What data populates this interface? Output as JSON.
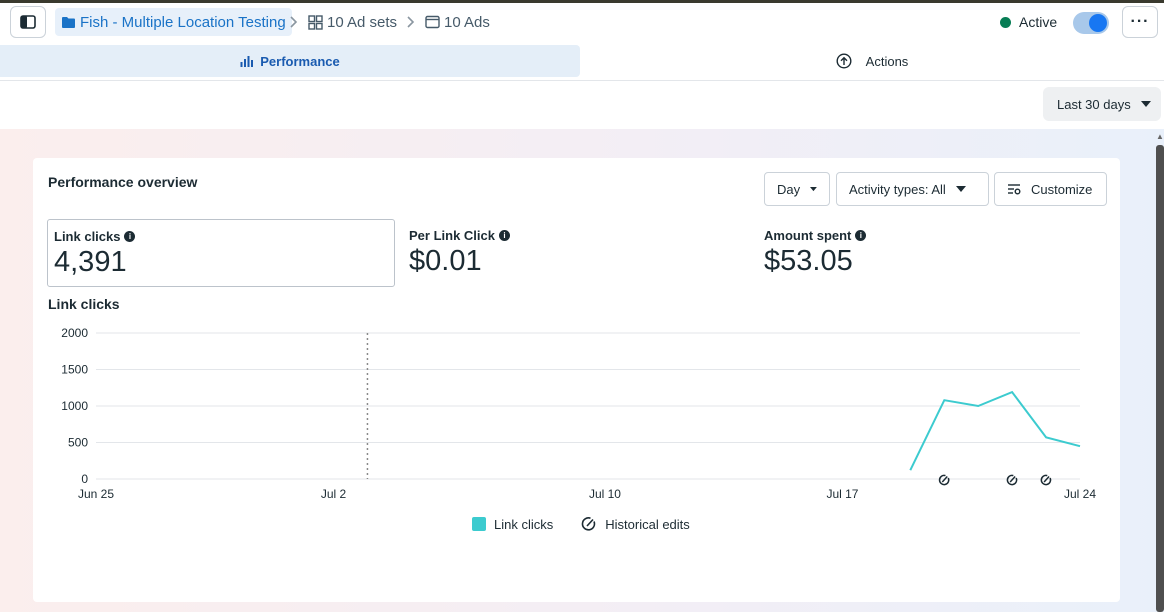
{
  "breadcrumb": {
    "campaign": "Fish - Multiple Location Testing",
    "adsets": "10 Ad sets",
    "ads": "10 Ads"
  },
  "status": {
    "label": "Active",
    "color": "#077d55"
  },
  "tabs": {
    "performance": "Performance",
    "actions": "Actions"
  },
  "date_range": "Last 30 days",
  "card": {
    "title": "Performance overview",
    "day_label": "Day",
    "activity_label": "Activity types: All",
    "customize_label": "Customize"
  },
  "metrics": [
    {
      "label": "Link clicks",
      "value": "4,391"
    },
    {
      "label": "Per Link Click",
      "value": "$0.01"
    },
    {
      "label": "Amount spent",
      "value": "$53.05"
    }
  ],
  "chart_title": "Link clicks",
  "legend": {
    "series": "Link clicks",
    "edits": "Historical edits"
  },
  "chart_data": {
    "type": "line",
    "x_ticks": [
      "Jun 25",
      "Jul 2",
      "Jul 10",
      "Jul 17",
      "Jul 24"
    ],
    "y_ticks": [
      0,
      500,
      1000,
      1500,
      2000
    ],
    "ylim": [
      0,
      2000
    ],
    "grid": true,
    "series": [
      {
        "name": "Link clicks",
        "color": "#3ccbcf",
        "points": [
          {
            "x": "Jul 19",
            "y": 120
          },
          {
            "x": "Jul 20",
            "y": 1080
          },
          {
            "x": "Jul 21",
            "y": 1000
          },
          {
            "x": "Jul 22",
            "y": 1190
          },
          {
            "x": "Jul 23",
            "y": 570
          },
          {
            "x": "Jul 24",
            "y": 450
          }
        ]
      }
    ],
    "marker_line": "Jul 3",
    "historical_edits": [
      "Jul 20",
      "Jul 22",
      "Jul 23"
    ]
  }
}
